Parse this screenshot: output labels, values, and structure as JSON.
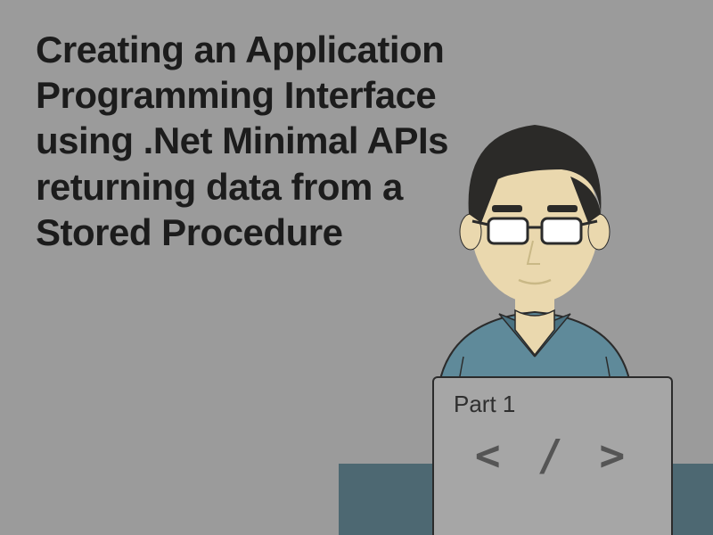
{
  "title": "Creating an Application Programming Interface using .Net Minimal APIs returning data from a Stored Procedure",
  "laptop": {
    "part_label": "Part 1",
    "code_glyph": "< / >"
  },
  "colors": {
    "background": "#9b9b9b",
    "desk": "#4d6872",
    "shirt": "#5f8a9a",
    "skin": "#ead8ae",
    "hair": "#2b2a28"
  }
}
